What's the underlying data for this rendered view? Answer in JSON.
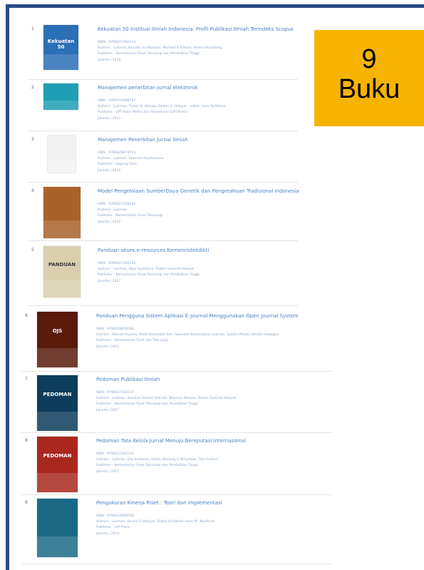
{
  "badge": {
    "count": "9",
    "label": "Buku"
  },
  "books": [
    {
      "num": "1",
      "title": "Kekuatan 50 Institusi Ilmiah Indonesia: Profil Publikasi Ilmiah Terindeks Scopus",
      "isbn": "ISBN : 9786027392113",
      "authors": "Authors : Lukman,Yanuadi, Ira Maryani, Michael A Silalahi, Andre Sihombing",
      "publisher": "Publisher : Kementerian Riset Teknologi dan Pendidikan Tinggi",
      "place_year": "Jakarta | 2018",
      "cover_text": "Kekuatan 50",
      "cover_color": "#2b6fb5"
    },
    {
      "num": "2",
      "title": "Manajemen penerbitan jurnal elektronik",
      "isbn": "ISBN : 9789797998767",
      "authors": "Authors : Lukman, Tinton D. Atmaja, Deden S. Hidayat ; editor, Heru Sulistyan",
      "publisher": "Publisher : UPT Balai Media dan Reproduksi (LIPI Press)",
      "place_year": "Jakarta | 2017",
      "cover_text": "",
      "cover_color": "#1e9fb5"
    },
    {
      "num": "3",
      "title": "Manajemen Penerbitan Jurnal Ilmiah",
      "isbn": "ISBN : 9786028674713",
      "authors": "Authors : Lukman, Sweesen Kustanyana",
      "publisher": "Publisher : Sagung Seto",
      "place_year": "Jakarta | 2012",
      "cover_text": "",
      "cover_color": "#f2f2f2"
    },
    {
      "num": "4",
      "title": "Model Pengelolaan SumberDaya Genetik dan Pengetahuan Tradisional Indonesia",
      "isbn": "ISBN : 9786027339202",
      "authors": "Authors : Lukman",
      "publisher": "Publisher : Kementerian Riset Teknologi",
      "place_year": "Jakarta | 2012",
      "cover_text": "",
      "cover_color": "#a8622a"
    },
    {
      "num": "5",
      "title": "Panduan akses e-resources Kemenristekdikti",
      "isbn": "ISBN : 9786027392144",
      "authors": "Authors : Lukman, Dipa Syahbana, Deden Sumirat Hidayat",
      "publisher": "Publisher : Kementerian Riset Teknologi dan Pendidikan Tinggi",
      "place_year": "Jakarta | 2017",
      "cover_text": "PANDUAN",
      "cover_color": "#d9cfae"
    },
    {
      "num": "6",
      "title": "Panduan Pengguna Sistem Aplikasi E-Journal Menggunakan Open Journal System",
      "isbn": "ISBN : 9786028659581",
      "authors": "Authors : Slamet Riyanto, Rarth Keumalah Sari, Sweesen Kustanyana, Lukman, Syaiful Afandi, Hendro Subagyo",
      "publisher": "Publisher : Kementerian Riset dan Teknologi",
      "place_year": "Jakarta | 2012",
      "cover_text": "OJS",
      "cover_color": "#5a1a0c"
    },
    {
      "num": "7",
      "title": "Pedoman Publikasi Ilmiah",
      "isbn": "ISBN : 9786027392137",
      "authors": "Authors : Lukman, Suminar Setiadi Ahmadi, Wasmen Manalu, Deden Sumirat Hidayat",
      "publisher": "Publisher : Kementerian Riset Teknologi dan Pendidikan Tinggi",
      "place_year": "Jakarta | 2017",
      "cover_text": "PEDOMAN",
      "cover_color": "#0c3d5c"
    },
    {
      "num": "8",
      "title": "Pedoman Tata Kelola Jurnal Menuju Bereputasi Internasional",
      "isbn": "ISBN : 9786027392151",
      "authors": "Authors : Lukman, Edy Soewono, Istadi, Komang G Wiryawan, Tole Sutikno",
      "publisher": "Publisher : Kementerian Riset Teknologi dan Pendidikan Tinggi",
      "place_year": "Jakarta | 2017",
      "cover_text": "PEDOMAN",
      "cover_color": "#a8281e"
    },
    {
      "num": "9",
      "title": "Pengukuran Kinerja Riset : Teori dan Implementasi",
      "isbn": "ISBN : 9786024960762",
      "authors": "Authors : Lukman, Deden S Hidayat, Shidiq Al-Hakiml Irene M.. Nadhirah",
      "publisher": "Publisher : LIPI Press",
      "place_year": "Jakarta | 2019",
      "cover_text": "",
      "cover_color": "#1a6a86"
    }
  ]
}
